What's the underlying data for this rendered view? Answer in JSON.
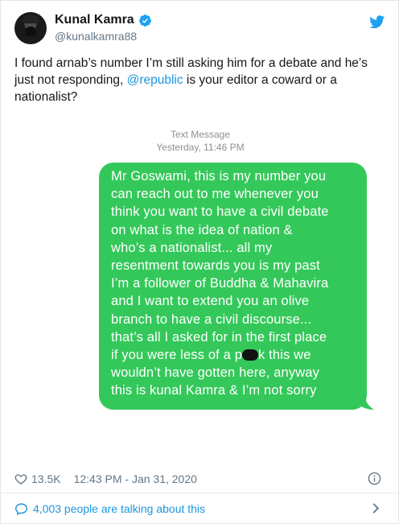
{
  "tweet": {
    "author": {
      "display_name": "Kunal Kamra",
      "handle": "@kunalkamra88",
      "verified": true
    },
    "text_before": "I found arnab’s number I’m still asking him for a debate and he’s just not responding, ",
    "mention": "@republic",
    "text_after": " is your editor a coward or a nationalist?",
    "likes": "13.5K",
    "timestamp": "12:43 PM - Jan 31, 2020",
    "conversation": "4,003 people are talking about this"
  },
  "message": {
    "service": "Text Message",
    "day": "Yesterday,",
    "time": "11:46 PM",
    "lines": [
      "Mr Goswami, this is my number you",
      "can reach out to me whenever you",
      "think you want to have a civil debate",
      "on what is the idea of nation &",
      "who’s a nationalist... all my",
      "resentment towards you is my past",
      "I’m a follower of Buddha & Mahavira",
      "and I want to extend you an olive",
      "branch to have a civil discourse...",
      "that’s all I asked for in the first place",
      "if you were less of a p",
      "k this we",
      "wouldn’t have gotten here, anyway",
      "this is kunal Kamra & I’m not sorry"
    ],
    "bubble_color": "#34c85a"
  },
  "colors": {
    "link": "#1b95e0",
    "secondary": "#657786",
    "verified": "#1da1f2"
  },
  "icons": {
    "header": [
      "verified-badge-icon",
      "twitter-bird-icon"
    ],
    "stats": [
      "heart-icon",
      "info-icon"
    ],
    "conversation": [
      "speech-bubble-icon",
      "chevron-right-icon"
    ]
  }
}
